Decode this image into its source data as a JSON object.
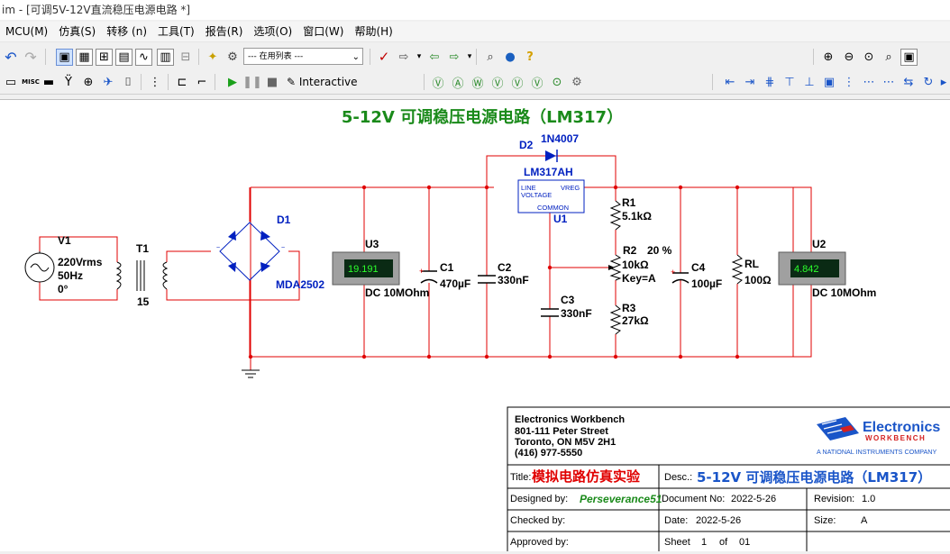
{
  "window": {
    "title": "im - [可调5V-12V直流稳压电源电路 *]"
  },
  "menu": [
    "MCU(M)",
    "仿真(S)",
    "转移 (n)",
    "工具(T)",
    "报告(R)",
    "选项(O)",
    "窗口(W)",
    "帮助(H)"
  ],
  "toolbar": {
    "in_use_list": "--- 在用列表 ---",
    "misc_label": "MISC",
    "interactive_label": "Interactive"
  },
  "schematic": {
    "title": "5-12V 可调稳压电源电路（LM317）",
    "source": {
      "name": "V1",
      "voltage": "220Vrms",
      "frequency": "50Hz",
      "phase": "0°"
    },
    "transformer": {
      "name": "T1",
      "ratio": "15"
    },
    "bridge": {
      "name": "D1",
      "part": "MDA2502"
    },
    "diode": {
      "name": "D2",
      "part": "1N4007"
    },
    "regulator": {
      "name": "U1",
      "part": "LM317AH",
      "pin_line": "LINE",
      "pin_voltage": "VOLTAGE",
      "pin_vreg": "VREG",
      "pin_common": "COMMON"
    },
    "c1": {
      "name": "C1",
      "value": "470µF",
      "polarity": "+"
    },
    "c2": {
      "name": "C2",
      "value": "330nF"
    },
    "c3": {
      "name": "C3",
      "value": "330nF"
    },
    "c4": {
      "name": "C4",
      "value": "100µF",
      "polarity": "+"
    },
    "r1": {
      "name": "R1",
      "value": "5.1kΩ"
    },
    "r2": {
      "name": "R2",
      "percent": "20 %",
      "value": "10kΩ",
      "key": "Key=A"
    },
    "r3": {
      "name": "R3",
      "value": "27kΩ"
    },
    "rl": {
      "name": "RL",
      "value": "100Ω"
    },
    "u3": {
      "name": "U3",
      "reading": "19.191",
      "mode": "DC  10MOhm"
    },
    "u2": {
      "name": "U2",
      "reading": "4.842",
      "mode": "DC  10MOhm"
    }
  },
  "titleblock": {
    "company": "Electronics Workbench",
    "address1": "801-111 Peter Street",
    "address2": "Toronto, ON M5V 2H1",
    "phone": "(416) 977-5550",
    "logo_line1": "Electronics",
    "logo_line2": "WORKBENCH",
    "logo_line3": "A NATIONAL INSTRUMENTS COMPANY",
    "title_label": "Title:",
    "title_value": "模拟电路仿真实验",
    "desc_label": "Desc.:",
    "desc_value": "5-12V 可调稳压电源电路（LM317）",
    "designed_label": "Designed by:",
    "designed_value": "Perseverance51",
    "docno_label": "Document No:",
    "docno_value": "2022-5-26",
    "revision_label": "Revision:",
    "revision_value": "1.0",
    "checked_label": "Checked by:",
    "date_label": "Date:",
    "date_value": "2022-5-26",
    "size_label": "Size:",
    "size_value": "A",
    "approved_label": "Approved by:",
    "sheet_label": "Sheet",
    "sheet_value": "1",
    "of_label": "of",
    "of_value": "01"
  },
  "colors": {
    "wire": "#e00000",
    "component": "#0020c0",
    "title": "#1a8a1a",
    "meter_bg": "#0a2a14",
    "meter_text": "#2cff2c"
  }
}
